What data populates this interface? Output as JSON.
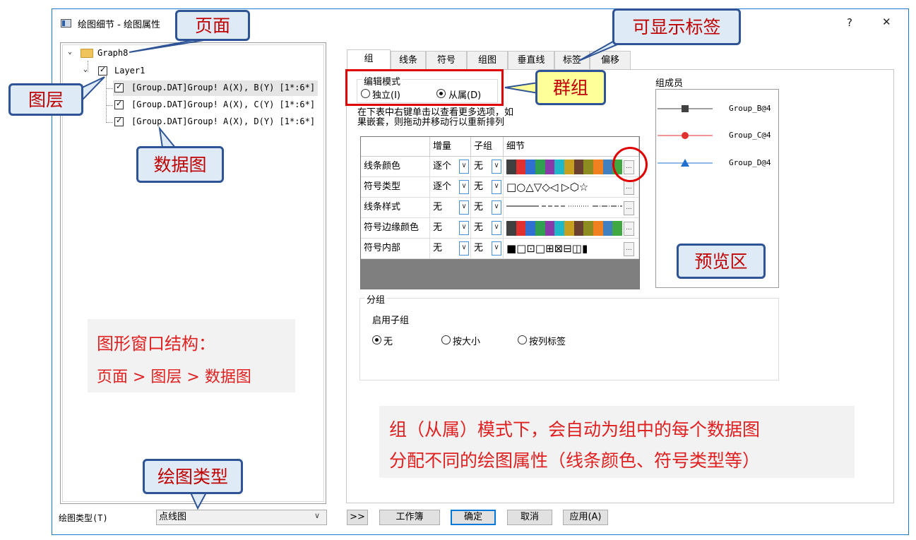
{
  "window": {
    "title": "绘图细节 - 绘图属性",
    "help_label": "?",
    "close_label": "✕"
  },
  "tree": {
    "root": "Graph8",
    "layer": "Layer1",
    "plots": [
      "[Group.DAT]Group! A(X), B(Y) [1*:6*]",
      "[Group.DAT]Group! A(X), C(Y) [1*:6*]",
      "[Group.DAT]Group! A(X), D(Y) [1*:6*]"
    ]
  },
  "callouts": {
    "page": "页面",
    "layer": "图层",
    "data_plot": "数据图",
    "tabs": "可显示标签",
    "group": "群组",
    "preview": "预览区",
    "plot_type": "绘图类型"
  },
  "tabs": [
    "组",
    "线条",
    "符号",
    "组图",
    "垂直线",
    "标签",
    "偏移"
  ],
  "edit_mode": {
    "label": "编辑模式",
    "options": [
      "独立(I)",
      "从属(D)"
    ],
    "selected": "从属(D)"
  },
  "hint": {
    "line1": "在下表中右键单击以查看更多选项，如",
    "line2": "果嵌套，则拖动并移动行以重新排列"
  },
  "grid": {
    "headers": [
      "",
      "增量",
      "子组",
      "细节"
    ],
    "rows": [
      {
        "name": "线条颜色",
        "increment": "逐个",
        "subgroup": "无"
      },
      {
        "name": "符号类型",
        "increment": "逐个",
        "subgroup": "无"
      },
      {
        "name": "线条样式",
        "increment": "无",
        "subgroup": "无"
      },
      {
        "name": "符号边缘颜色",
        "increment": "无",
        "subgroup": "无"
      },
      {
        "name": "符号内部",
        "increment": "无",
        "subgroup": "无"
      }
    ],
    "palette": [
      "#404040",
      "#e03030",
      "#3070d0",
      "#30a050",
      "#8a3aa8",
      "#20b8c8",
      "#c8a020",
      "#6a4030",
      "#8c8c20",
      "#f08020",
      "#4080c0",
      "#40a840"
    ],
    "symbols": "□○△▽◇◁ ▷⬡☆",
    "fills": "■□⊡□⊞⊠⊟◫▮",
    "ellipsis": "..."
  },
  "members": {
    "label": "组成员",
    "items": [
      {
        "name": "Group_B@4",
        "color": "#404040",
        "shape": "square"
      },
      {
        "name": "Group_C@4",
        "color": "#e03030",
        "shape": "circle"
      },
      {
        "name": "Group_D@4",
        "color": "#1f6fd0",
        "shape": "triangle"
      }
    ]
  },
  "subgroup": {
    "label": "分组",
    "enable_label": "启用子组",
    "options": [
      "无",
      "按大小",
      "按列标签"
    ],
    "selected": "无"
  },
  "notes": {
    "structure_title": "图形窗口结构：",
    "structure_body": "页面 > 图层 > 数据图",
    "group_line1": "组（从属）模式下，会自动为组中的每个数据图",
    "group_line2": "分配不同的绘图属性（线条颜色、符号类型等）"
  },
  "footer": {
    "plot_type_label": "绘图类型(T)",
    "plot_type_value": "点线图",
    "expand_label": ">>",
    "workbook_label": "工作簿",
    "ok_label": "确定",
    "cancel_label": "取消",
    "apply_label": "应用(A)"
  },
  "colors": {
    "accent_blue": "#1e7ad4",
    "callout_border": "#2f5496",
    "callout_fill": "#deebf7",
    "callout_text": "#c00000",
    "highlight_red": "#e00000",
    "note_text": "#e02020"
  }
}
